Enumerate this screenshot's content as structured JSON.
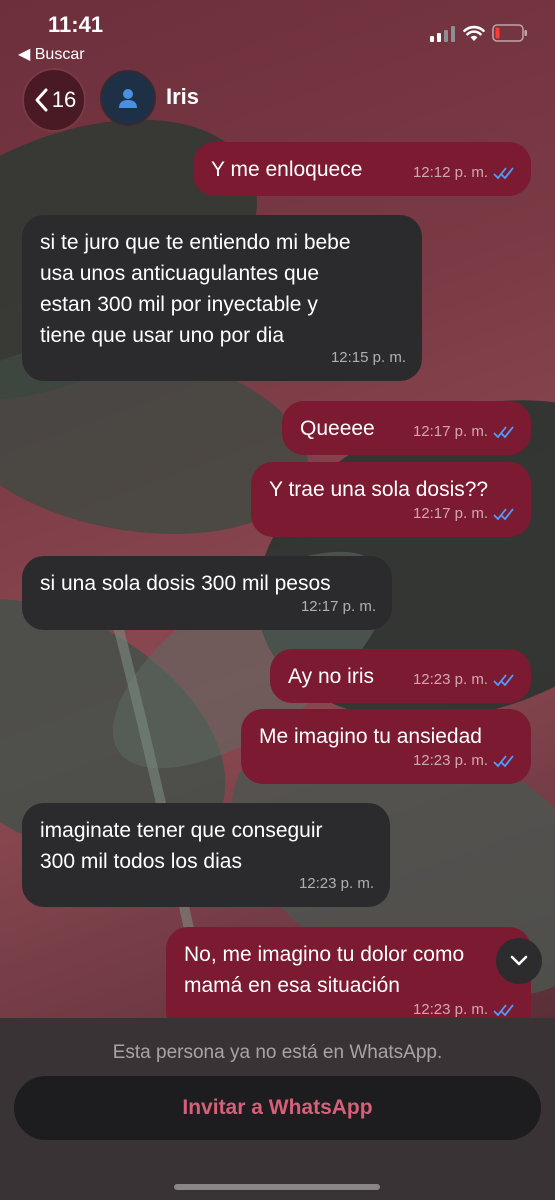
{
  "status_bar": {
    "time": "11:41",
    "back_app": "◀ Buscar",
    "battery_color": "#ff3b30"
  },
  "header": {
    "back_count": "16",
    "contact_name": "Iris"
  },
  "messages": [
    {
      "dir": "out",
      "text": "Y me enloquece",
      "time": "12:12 p. m.",
      "read": true
    },
    {
      "dir": "in",
      "text": "si te juro que te entiendo mi bebe\nusa unos anticuagulantes que\nestan 300 mil por inyectable y\ntiene que usar uno por dia",
      "time": "12:15 p. m."
    },
    {
      "dir": "out",
      "text": "Queeee",
      "time": "12:17 p. m.",
      "read": true
    },
    {
      "dir": "out",
      "text": "Y trae una sola dosis??",
      "time": "12:17 p. m.",
      "read": true
    },
    {
      "dir": "in",
      "text": "si una sola dosis 300 mil pesos",
      "time": "12:17 p. m."
    },
    {
      "dir": "out",
      "text": "Ay no iris",
      "time": "12:23 p. m.",
      "read": true
    },
    {
      "dir": "out",
      "text": "Me imagino tu ansiedad",
      "time": "12:23 p. m.",
      "read": true
    },
    {
      "dir": "in",
      "text": "imaginate tener que conseguir\n300 mil todos los dias",
      "time": "12:23 p. m."
    },
    {
      "dir": "out",
      "text": "No, me imagino tu dolor como\nmamá en esa situación",
      "time": "12:23 p. m.",
      "read": true
    }
  ],
  "footer": {
    "notice": "Esta persona ya no está en WhatsApp.",
    "invite_label": "Invitar a WhatsApp"
  },
  "colors": {
    "outgoing_bubble": "#7b1a30",
    "incoming_bubble": "#2b2b2e",
    "read_ticks": "#4f9cff",
    "invite_text": "#d6607a"
  }
}
